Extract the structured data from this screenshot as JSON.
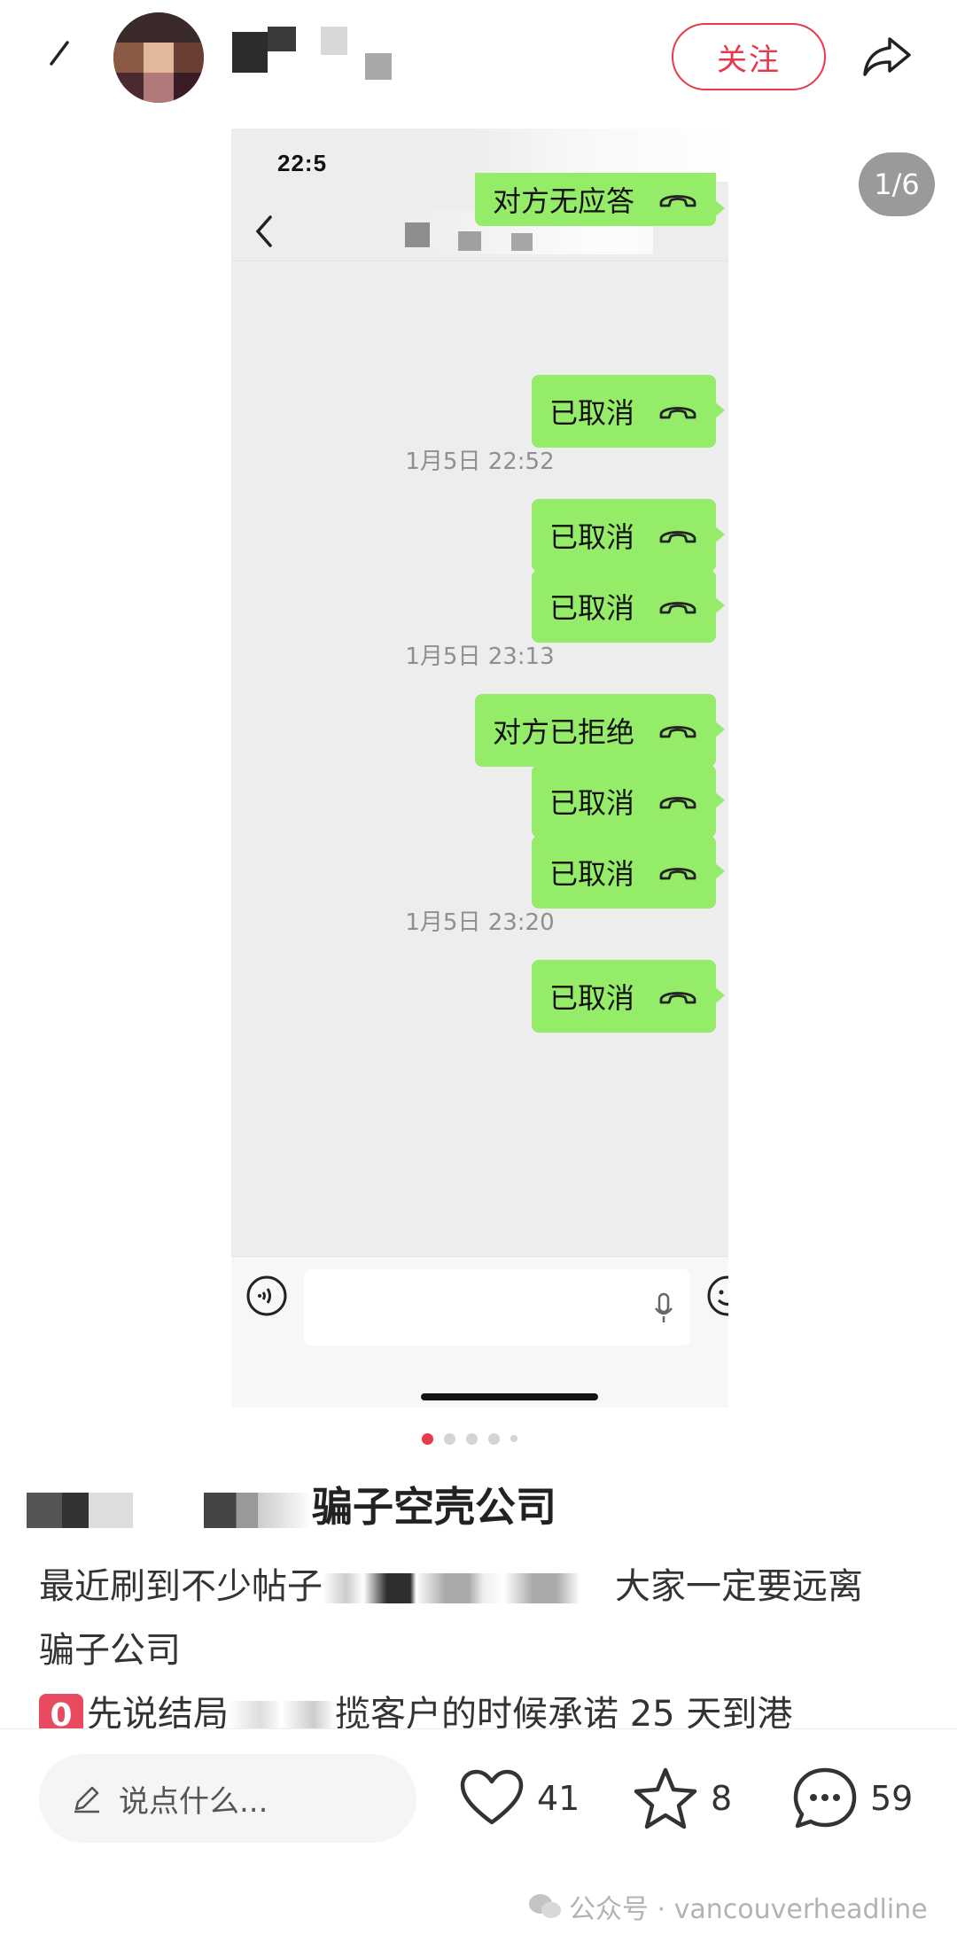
{
  "header": {
    "follow_label": "关注",
    "author_name": ""
  },
  "carousel": {
    "counter": "1/6",
    "dots": 5,
    "active_dot": 0
  },
  "chat": {
    "status_time": "22:5",
    "messages": [
      {
        "kind": "call",
        "text": "对方无应答"
      },
      {
        "kind": "call",
        "text": "已取消"
      },
      {
        "kind": "time",
        "text": "1月5日 22:52"
      },
      {
        "kind": "call",
        "text": "已取消"
      },
      {
        "kind": "call",
        "text": "已取消"
      },
      {
        "kind": "time",
        "text": "1月5日 23:13"
      },
      {
        "kind": "call",
        "text": "对方已拒绝"
      },
      {
        "kind": "call",
        "text": "已取消"
      },
      {
        "kind": "call",
        "text": "已取消"
      },
      {
        "kind": "time",
        "text": "1月5日 23:20"
      },
      {
        "kind": "call",
        "text": "已取消"
      }
    ]
  },
  "post": {
    "title_visible": "骗子空壳公司",
    "body_line1_start": "最近刷到不少帖子",
    "body_line1_end": "大家一定要远离",
    "body_line2": "骗子公司",
    "body_line3_badge": "0",
    "body_line3_start": "先说结局",
    "body_line3_end": "揽客户的时候承诺",
    "body_line3_num": "25",
    "body_line3_tail": "天到港"
  },
  "bottom": {
    "comment_placeholder": "说点什么...",
    "likes": "41",
    "favorites": "8",
    "comments": "59",
    "watermark": "公众号 · vancouverheadline"
  },
  "colors": {
    "accent": "#e8394a",
    "bubble": "#95ec69"
  }
}
